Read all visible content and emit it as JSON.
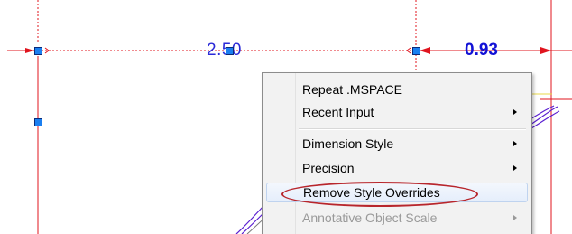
{
  "drawing": {
    "dimension_left": "2.50",
    "dimension_right": "0.93",
    "colors": {
      "extension_line": "#e0141e",
      "dimension_text_left": "#2a2ad8",
      "dimension_text_right": "#1212d6",
      "grip": "#1b7ff0",
      "curve": "#5a1fd1"
    }
  },
  "context_menu": {
    "items": [
      {
        "label": "Repeat .MSPACE",
        "has_submenu": false,
        "disabled": false
      },
      {
        "label": "Recent Input",
        "has_submenu": true,
        "disabled": false
      },
      {
        "label": "Dimension Style",
        "has_submenu": true,
        "disabled": false
      },
      {
        "label": "Precision",
        "has_submenu": true,
        "disabled": false
      },
      {
        "label": "Remove Style Overrides",
        "has_submenu": false,
        "disabled": false,
        "highlighted": true
      },
      {
        "label": "Annotative Object Scale",
        "has_submenu": true,
        "disabled": true
      }
    ],
    "callout_color": "#b8262c"
  }
}
